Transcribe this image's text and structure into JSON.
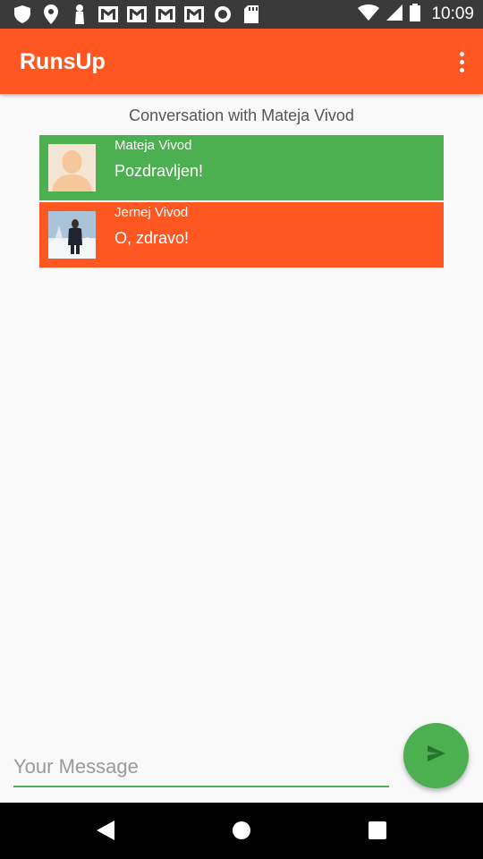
{
  "status_bar": {
    "time": "10:09",
    "left_icons": [
      "shield-icon",
      "location-icon",
      "bolt-icon",
      "gmail-icon",
      "gmail-icon",
      "gmail-icon",
      "gmail-icon",
      "circle-icon",
      "sd-card-icon"
    ],
    "right_icons": [
      "wifi-icon",
      "cell-signal-icon",
      "battery-icon"
    ]
  },
  "app_bar": {
    "title": "RunsUp",
    "menu_icon": "more-vert-icon",
    "color": "#ff5722"
  },
  "conversation": {
    "header": "Conversation with Mateja Vivod",
    "messages": [
      {
        "sender": "Mateja Vivod",
        "text": "Pozdravljen!",
        "color": "#4caf50",
        "avatar": "default-avatar"
      },
      {
        "sender": "Jernej Vivod",
        "text": "O, zdravo!",
        "color": "#ff5722",
        "avatar": "photo-avatar"
      }
    ]
  },
  "composer": {
    "placeholder": "Your Message",
    "value": "",
    "send_icon": "send-icon",
    "accent": "#4caf50"
  },
  "nav_bar": {
    "buttons": [
      "back-icon",
      "home-icon",
      "recents-icon"
    ]
  }
}
